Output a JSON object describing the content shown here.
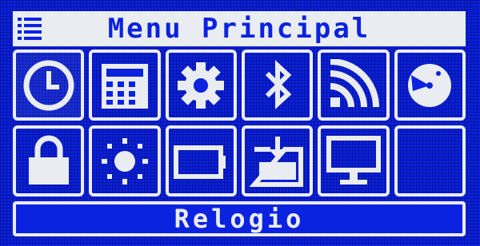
{
  "header": {
    "title": "Menu Principal",
    "menu_icon": "hamburger-icon"
  },
  "grid": {
    "tiles": [
      {
        "id": "clock",
        "icon": "clock-icon"
      },
      {
        "id": "calculator",
        "icon": "calculator-icon"
      },
      {
        "id": "settings",
        "icon": "gear-icon"
      },
      {
        "id": "bluetooth",
        "icon": "bluetooth-icon"
      },
      {
        "id": "wifi",
        "icon": "wifi-icon"
      },
      {
        "id": "time-alt",
        "icon": "clock-face-icon"
      },
      {
        "id": "lock",
        "icon": "lock-icon"
      },
      {
        "id": "brightness",
        "icon": "sun-icon"
      },
      {
        "id": "battery",
        "icon": "battery-icon"
      },
      {
        "id": "download",
        "icon": "download-icon"
      },
      {
        "id": "display",
        "icon": "monitor-icon"
      },
      {
        "id": "empty",
        "icon": ""
      }
    ]
  },
  "footer": {
    "selected_label": "Relogio"
  },
  "colors": {
    "background": "#0b22e0",
    "foreground": "#e9ecf0"
  }
}
